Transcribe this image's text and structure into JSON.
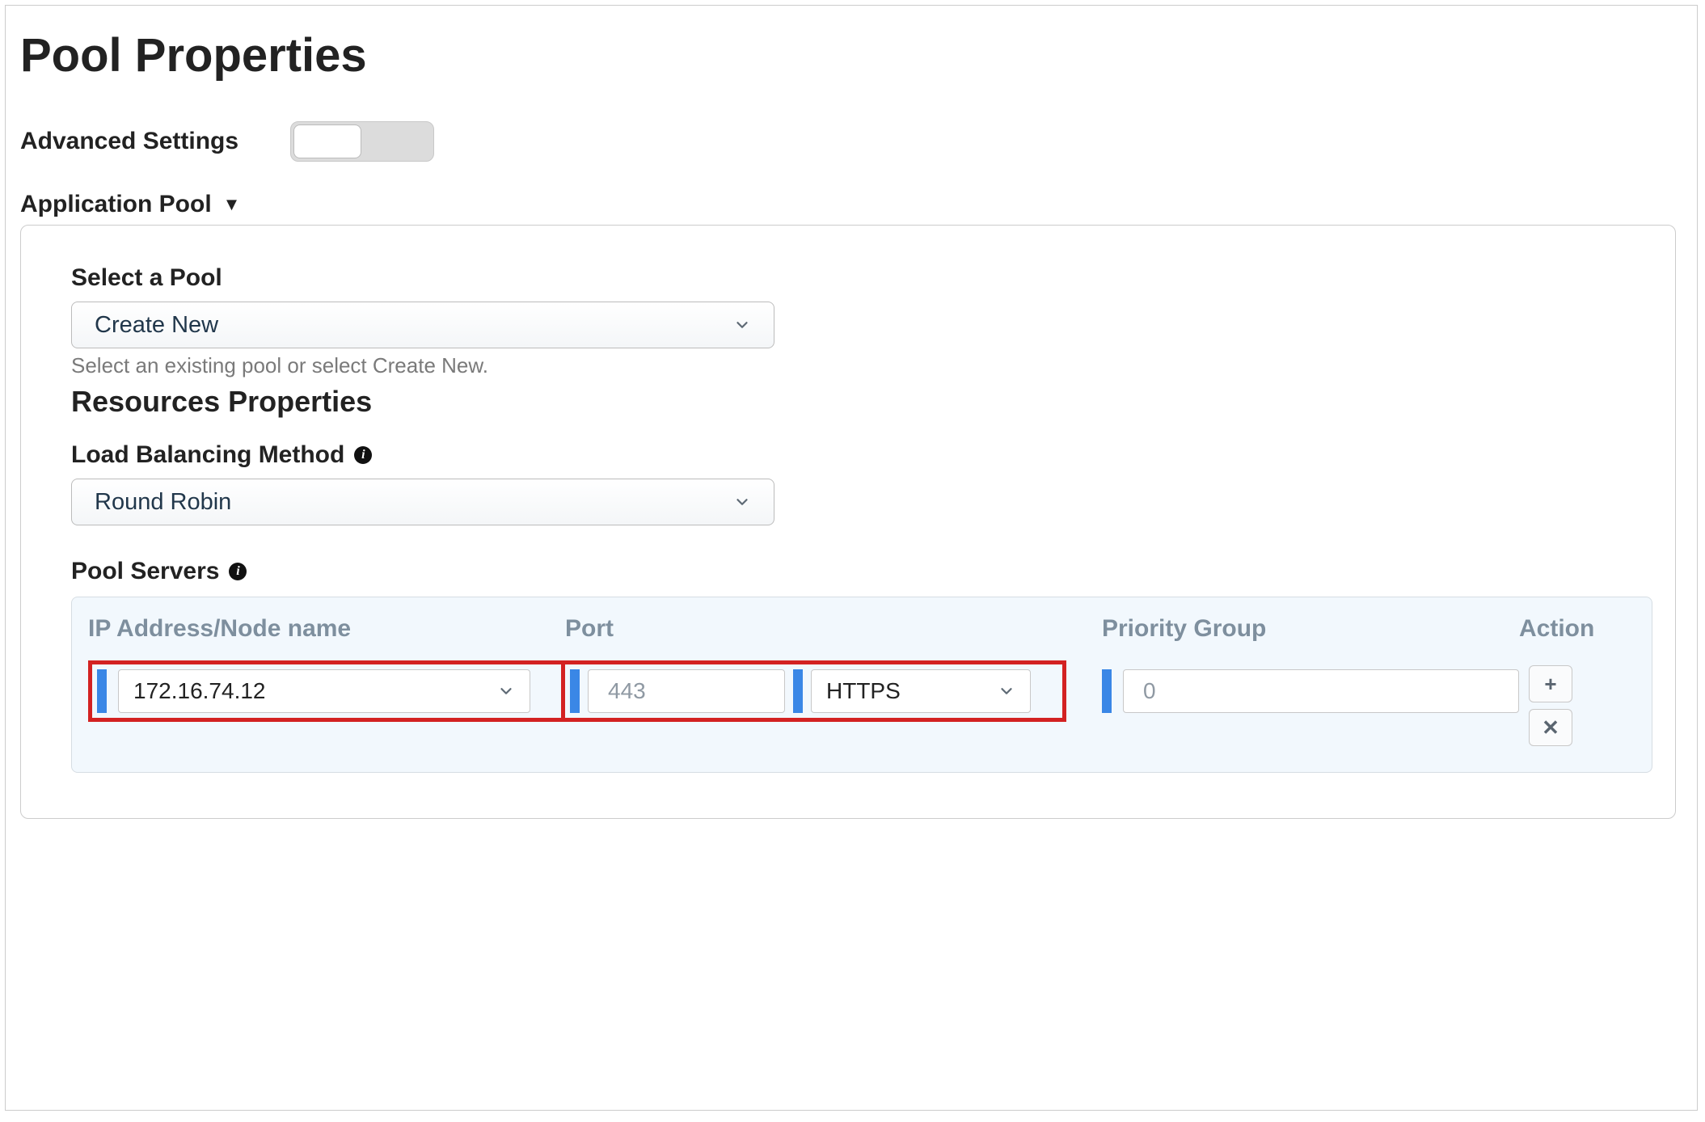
{
  "page": {
    "title": "Pool Properties",
    "advanced_label": "Advanced Settings",
    "advanced_on": false
  },
  "sections": {
    "app_pool": {
      "heading": "Application Pool",
      "select_pool_label": "Select a Pool",
      "select_pool_value": "Create New",
      "select_pool_hint": "Select an existing pool or select Create New.",
      "resources_heading": "Resources Properties",
      "lbm_label": "Load Balancing Method",
      "lbm_value": "Round Robin",
      "pool_servers_label": "Pool Servers",
      "table": {
        "headers": {
          "ip": "IP Address/Node name",
          "port": "Port",
          "priority": "Priority Group",
          "action": "Action"
        },
        "row": {
          "ip": "172.16.74.12",
          "port": "443",
          "protocol": "HTTPS",
          "priority": "0"
        }
      }
    }
  },
  "icons": {
    "info": "i",
    "plus": "+",
    "times": "✕"
  }
}
